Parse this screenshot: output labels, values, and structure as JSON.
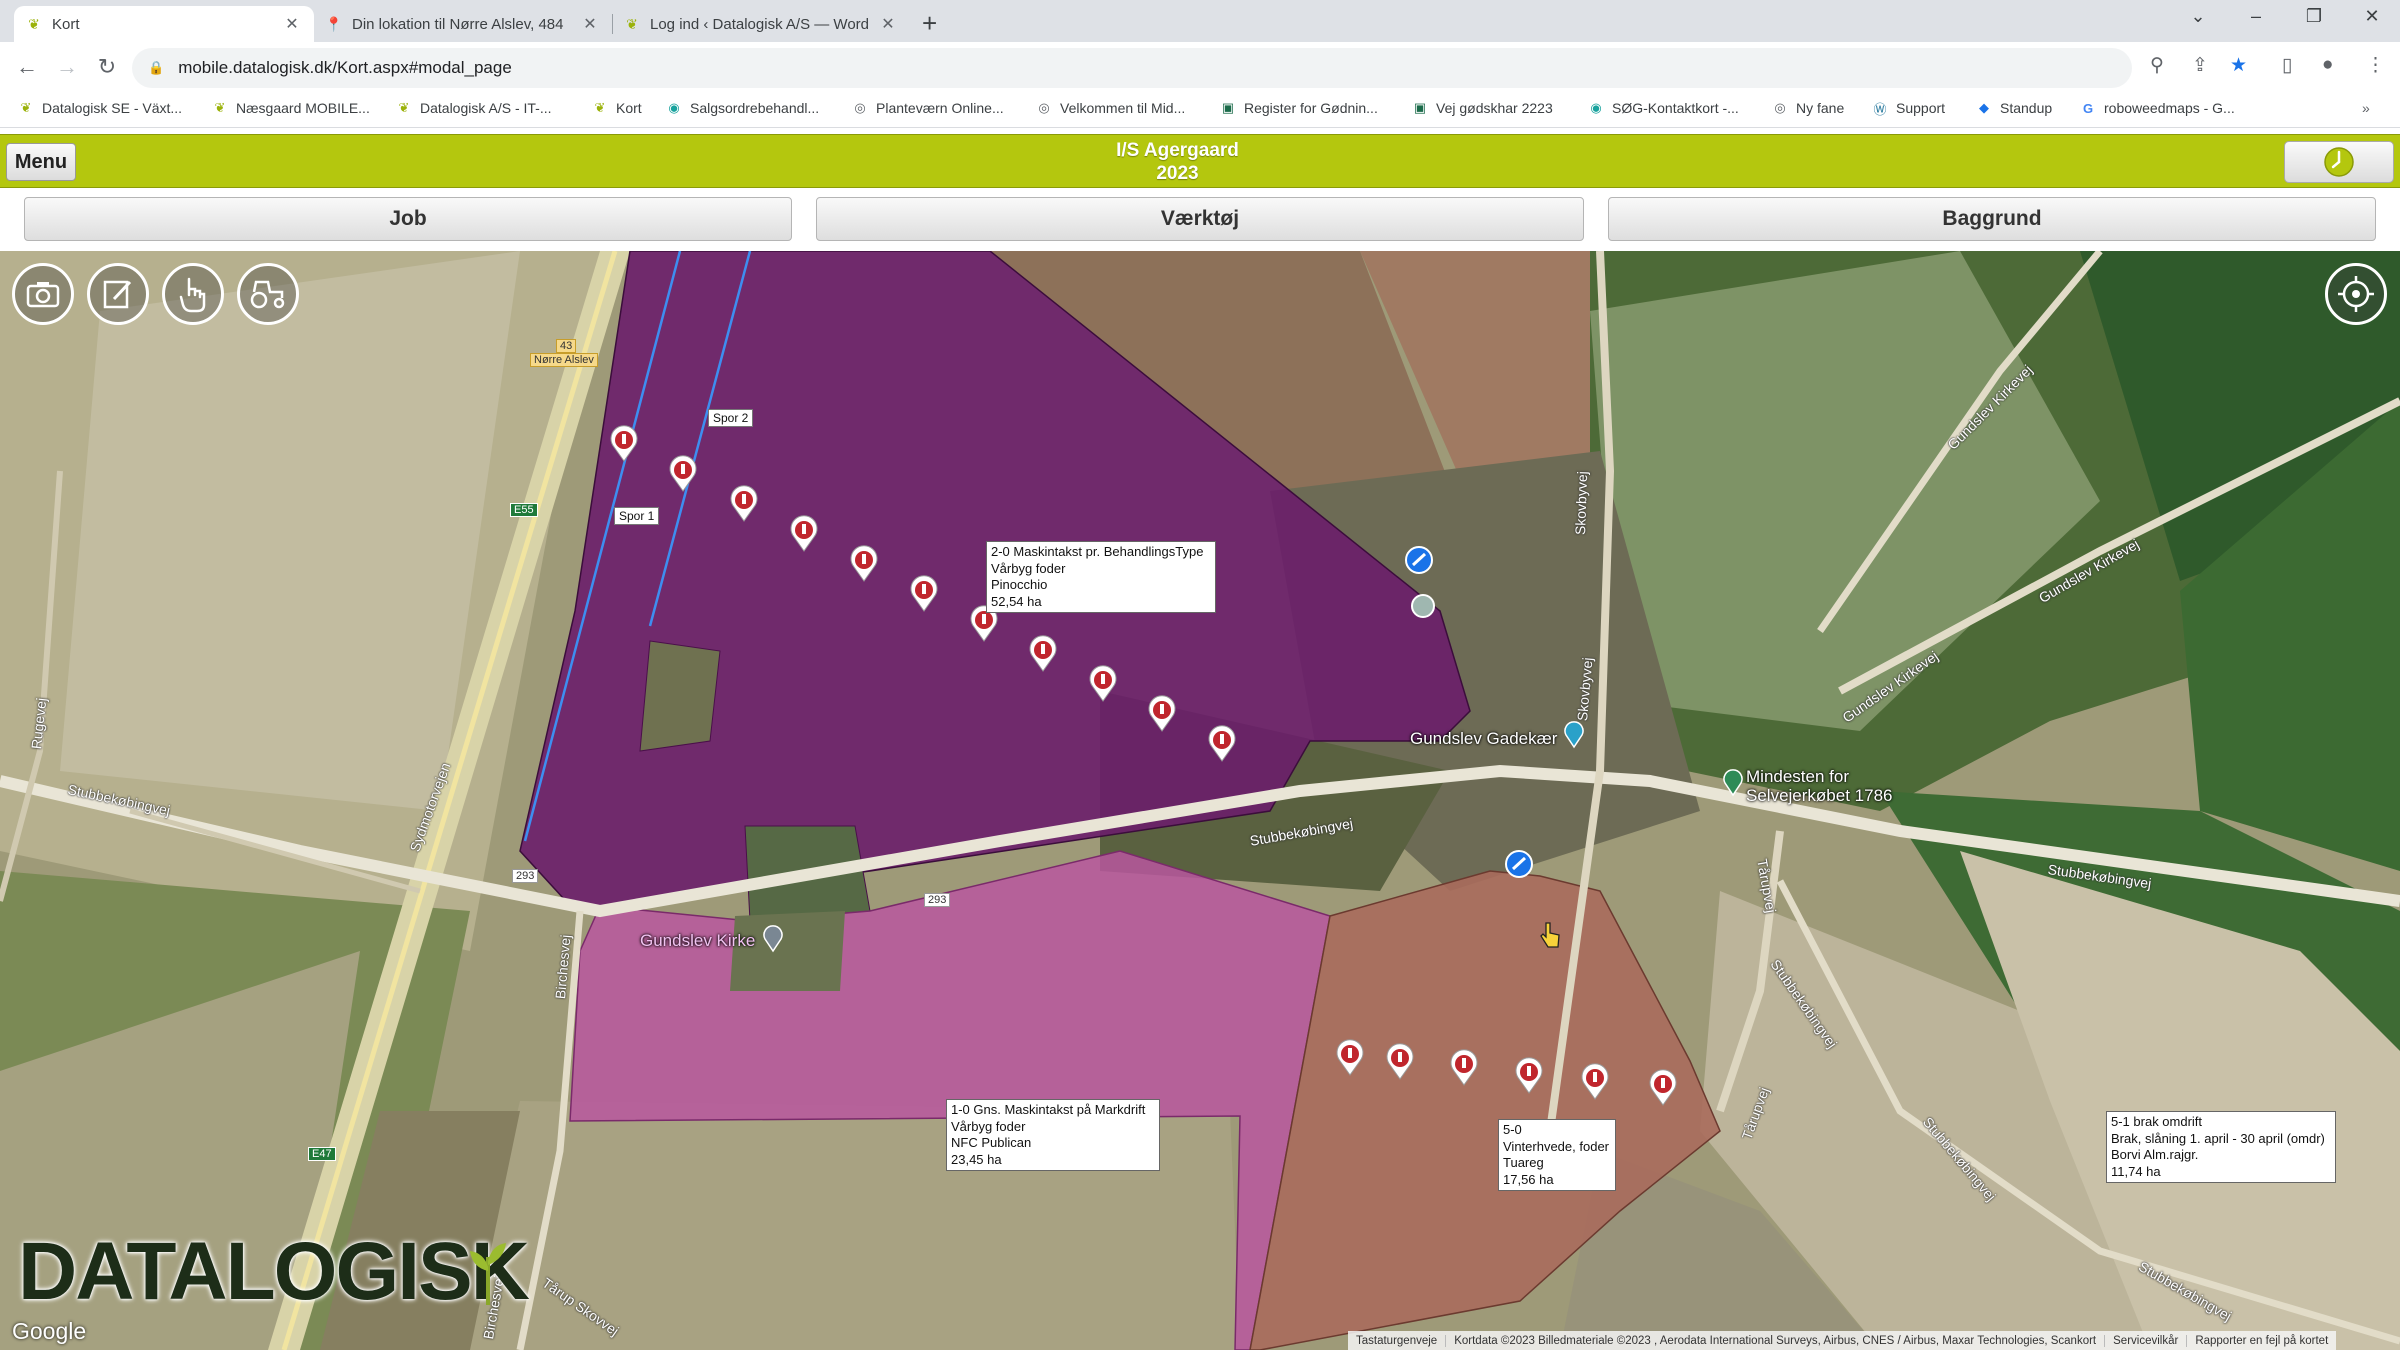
{
  "browser": {
    "tabs": [
      {
        "title": "Kort",
        "icon": "datalogisk-leaf-icon"
      },
      {
        "title": "Din lokation til Nørre Alslev, 484",
        "icon": "maps-pin-icon"
      },
      {
        "title": "Log ind ‹ Datalogisk A/S — Word",
        "icon": "datalogisk-leaf-icon"
      }
    ],
    "url": "mobile.datalogisk.dk/Kort.aspx#modal_page",
    "bookmarks": [
      "Datalogisk SE - Växt...",
      "Næsgaard MOBILE...",
      "Datalogisk A/S - IT-...",
      "Kort",
      "Salgsordrebehandl...",
      "Planteværn Online...",
      "Velkommen til Mid...",
      "Register for Gødnin...",
      "Vej gødskhar 2223",
      "SØG-Kontaktkort -...",
      "Ny fane",
      "Support",
      "Standup",
      "roboweedmaps - G..."
    ]
  },
  "app": {
    "menu_label": "Menu",
    "title_line1": "I/S Agergaard",
    "title_line2": "2023",
    "nav": {
      "job": "Job",
      "tools": "Værktøj",
      "background": "Baggrund"
    },
    "accent_color": "#b4c70e"
  },
  "map": {
    "fields": [
      {
        "lines": [
          "2-0 Maskintakst pr. BehandlingsType",
          "Vårbyg foder",
          "Pinocchio",
          "52,54 ha"
        ]
      },
      {
        "lines": [
          "1-0 Gns. Maskintakst på Markdrift",
          "Vårbyg foder",
          "NFC Publican",
          "23,45 ha"
        ]
      },
      {
        "lines": [
          "5-0",
          "Vinterhvede, foder",
          "Tuareg",
          "17,56 ha"
        ]
      },
      {
        "lines": [
          "5-1 brak omdrift",
          "Brak, slåning 1. april - 30 april (omdr)",
          "Borvi Alm.rajgr.",
          "11,74 ha"
        ]
      }
    ],
    "tracks": {
      "spor1": "Spor 1",
      "spor2": "Spor 2"
    },
    "places": {
      "church": "Gundslev Kirke",
      "pond": "Gundslev Gadekær",
      "memorial_1": "Mindesten for",
      "memorial_2": "Selvejerkøbet 1786",
      "town": "Nørre Alslev"
    },
    "roads": {
      "stubbekobingvej": "Stubbekøbingvej",
      "sydmotorvejen": "Sydmotorvejen",
      "skovbyvej": "Skovbyvej",
      "gundslev_kirkevej": "Gundslev Kirkevej",
      "birchesvej": "Birchesvej",
      "taruprej": "Tårup Skovvej",
      "tarupvej": "Tårupvej",
      "stubbekobingvej2": "Stubbekøbingvej",
      "rugevej": "Rugevej"
    },
    "road_numbers": {
      "r293": "293",
      "r293b": "293",
      "e55": "E55",
      "e47": "E47",
      "r43": "43"
    },
    "logo": "DATALOGISK",
    "google": "Google",
    "attribution": [
      "Tastaturgenveje",
      "Kortdata ©2023 Billedmateriale ©2023 , Aerodata International Surveys, Airbus, CNES / Airbus, Maxar Technologies, Scankort",
      "Servicevilkår",
      "Rapporter en fejl på kortet"
    ],
    "colors": {
      "purple_field": "#6a1e6a",
      "pink_field": "#b8579f",
      "red_field": "#a96c5c",
      "marker": "#c0262d"
    }
  }
}
